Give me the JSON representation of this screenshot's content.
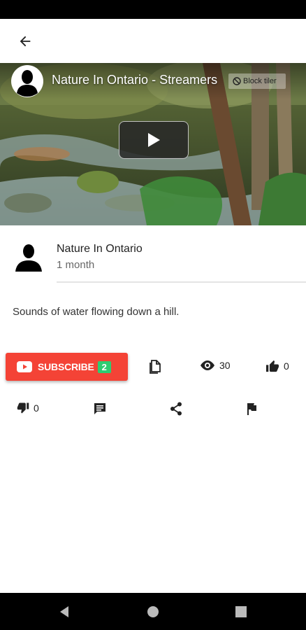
{
  "video": {
    "title": "Nature In Ontario - Streamers",
    "block_label": "Block tiler"
  },
  "channel": {
    "name": "Nature In Ontario",
    "time_ago": "1 month"
  },
  "description": "Sounds of water flowing down a hill.",
  "actions": {
    "subscribe_label": "SUBSCRIBE",
    "subscriber_count": "2",
    "views": "30",
    "likes": "0",
    "dislikes": "0"
  },
  "icons": [
    "back-arrow-icon",
    "play-icon",
    "youtube-icon",
    "copy-icon",
    "eye-icon",
    "thumb-up-icon",
    "thumb-down-icon",
    "comment-icon",
    "share-icon",
    "flag-icon"
  ],
  "colors": {
    "subscribe": "#f44336",
    "badge": "#2ecc71"
  }
}
